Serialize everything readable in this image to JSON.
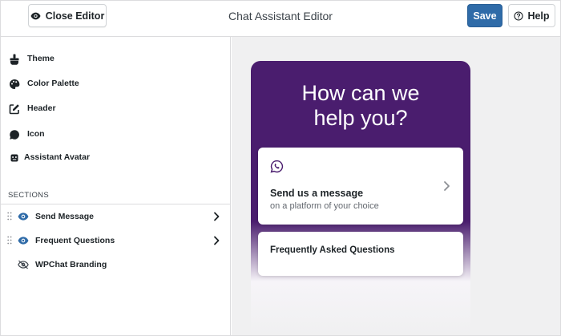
{
  "header": {
    "close_label": "Close Editor",
    "title": "Chat Assistant Editor",
    "save_label": "Save",
    "help_label": "Help"
  },
  "sidebar": {
    "items": [
      {
        "label": "Theme",
        "icon": "brush-icon"
      },
      {
        "label": "Color Palette",
        "icon": "palette-icon"
      },
      {
        "label": "Header",
        "icon": "edit-square-icon"
      },
      {
        "label": "Icon",
        "icon": "chat-bubble-icon"
      },
      {
        "label": "Assistant Avatar",
        "icon": "robot-icon"
      }
    ],
    "sections_label": "SECTIONS",
    "sections": [
      {
        "label": "Send Message",
        "visible": true
      },
      {
        "label": "Frequent Questions",
        "visible": true
      },
      {
        "label": "WPChat Branding",
        "visible": false
      }
    ]
  },
  "preview": {
    "headline_line1": "How can we",
    "headline_line2": "help you?",
    "card_send": {
      "title": "Send us a message",
      "subtitle": "on a platform of your choice",
      "icon": "whatsapp-icon"
    },
    "card_faq": {
      "title": "Frequently Asked Questions"
    }
  },
  "colors": {
    "accent": "#2f6ba8",
    "brand_purple": "#4a1d6e",
    "preview_bg": "#f0f0f1"
  }
}
